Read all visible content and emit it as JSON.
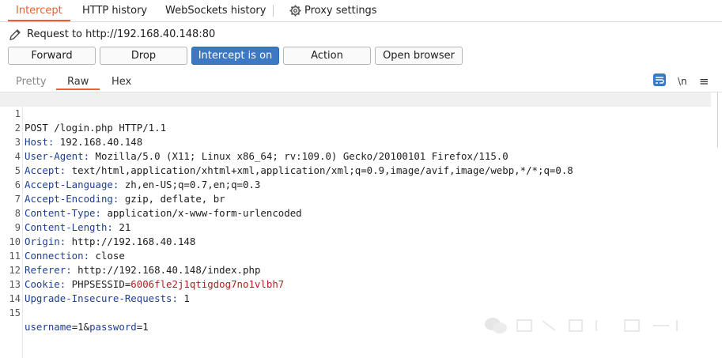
{
  "tabs": {
    "intercept": "Intercept",
    "http_history": "HTTP history",
    "websockets_history": "WebSockets history",
    "proxy_settings": "Proxy settings"
  },
  "request": {
    "label": "Request to http://192.168.40.148:80"
  },
  "buttons": {
    "forward": "Forward",
    "drop": "Drop",
    "intercept_on": "Intercept is on",
    "action": "Action",
    "open_browser": "Open browser"
  },
  "view_tabs": {
    "pretty": "Pretty",
    "raw": "Raw",
    "hex": "Hex"
  },
  "toolbar": {
    "newline_toggle": "\\n",
    "menu": "≡"
  },
  "editor": {
    "lines": [
      {
        "num": "1",
        "text": "POST /login.php HTTP/1.1"
      },
      {
        "num": "2",
        "key": "Host:",
        "val": " 192.168.40.148"
      },
      {
        "num": "3",
        "key": "User-Agent:",
        "val": " Mozilla/5.0 (X11; Linux x86_64; rv:109.0) Gecko/20100101 Firefox/115.0"
      },
      {
        "num": "4",
        "key": "Accept:",
        "val": " text/html,application/xhtml+xml,application/xml;q=0.9,image/avif,image/webp,*/*;q=0.8"
      },
      {
        "num": "5",
        "key": "Accept-Language:",
        "val": " zh,en-US;q=0.7,en;q=0.3"
      },
      {
        "num": "6",
        "key": "Accept-Encoding:",
        "val": " gzip, deflate, br"
      },
      {
        "num": "7",
        "key": "Content-Type:",
        "val": " application/x-www-form-urlencoded"
      },
      {
        "num": "8",
        "key": "Content-Length:",
        "val": " 21"
      },
      {
        "num": "9",
        "key": "Origin:",
        "val": " http://192.168.40.148"
      },
      {
        "num": "10",
        "key": "Connection:",
        "val": " close"
      },
      {
        "num": "11",
        "key": "Referer:",
        "val": " http://192.168.40.148/index.php"
      },
      {
        "num": "12",
        "key": "Cookie:",
        "val": " PHPSESSID=",
        "cookie": "6006fle2j1qtigdog7no1vlbh7"
      },
      {
        "num": "13",
        "key": "Upgrade-Insecure-Requests:",
        "val": " 1"
      },
      {
        "num": "14",
        "text": ""
      },
      {
        "num": "15",
        "body_user_key": "username",
        "body_user_eq": "=1&",
        "body_pass_key": "password",
        "body_pass_eq": "=1"
      }
    ]
  },
  "colors": {
    "accent": "#e8612c",
    "intercept_on": "#3c78c3",
    "header_key": "#1f3f94",
    "cookie_value": "#b02020"
  },
  "icons": {
    "proxy_settings": "gear-icon",
    "request_edit": "pencil-icon",
    "wrap": "wrap-lines-icon",
    "menu": "hamburger-icon"
  }
}
